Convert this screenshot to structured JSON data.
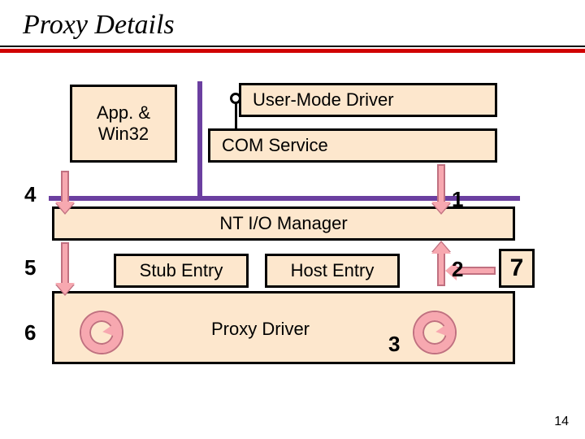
{
  "title": "Proxy Details",
  "slide_number": "14",
  "boxes": {
    "app_win32": "App. &\nWin32",
    "user_mode_driver": "User-Mode Driver",
    "com_service": "COM Service",
    "nt_io_manager": "NT I/O Manager",
    "stub_entry": "Stub Entry",
    "host_entry": "Host Entry",
    "proxy_driver": "Proxy Driver"
  },
  "labels": {
    "n1": "1",
    "n2": "2",
    "n3": "3",
    "n4": "4",
    "n5": "5",
    "n6": "6",
    "n7": "7"
  }
}
